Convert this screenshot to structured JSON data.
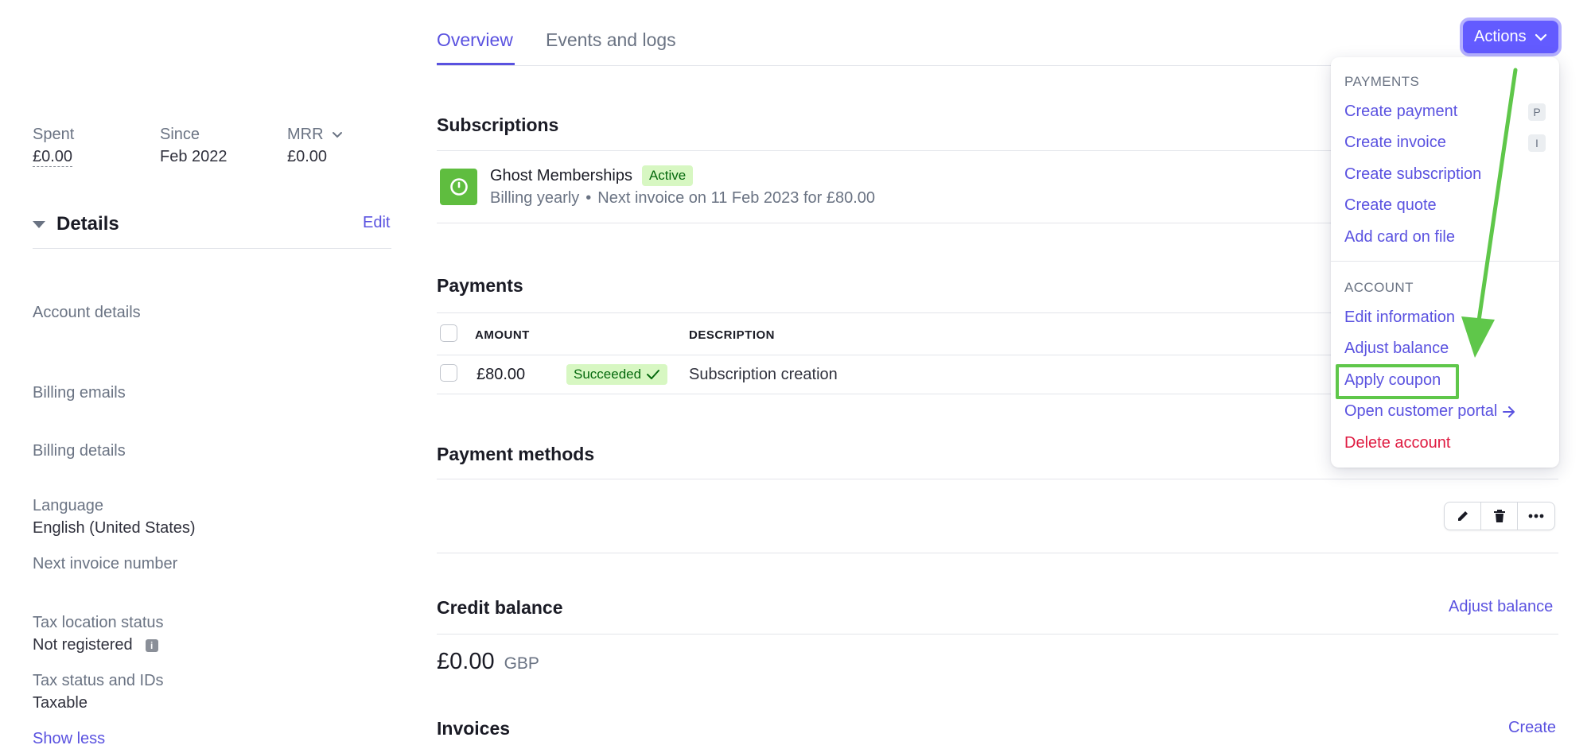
{
  "stats": {
    "spent_label": "Spent",
    "spent_value": "£0.00",
    "since_label": "Since",
    "since_value": "Feb 2022",
    "mrr_label": "MRR",
    "mrr_value": "£0.00"
  },
  "details": {
    "title": "Details",
    "edit_label": "Edit",
    "account_details": "Account details",
    "billing_emails": "Billing emails",
    "billing_details": "Billing details",
    "language_label": "Language",
    "language_value": "English (United States)",
    "next_invoice_number": "Next invoice number",
    "tax_location_label": "Tax location status",
    "tax_location_value": "Not registered",
    "tax_status_label": "Tax status and IDs",
    "tax_status_value": "Taxable",
    "show_less": "Show less"
  },
  "tabs": [
    {
      "label": "Overview"
    },
    {
      "label": "Events and logs"
    }
  ],
  "actions_button": {
    "label": "Actions"
  },
  "subscriptions": {
    "title": "Subscriptions",
    "name": "Ghost Memberships",
    "status": "Active",
    "billing": "Billing yearly",
    "next_invoice": "Next invoice on 11 Feb 2023 for £80.00"
  },
  "payments": {
    "title": "Payments",
    "columns": [
      "AMOUNT",
      "DESCRIPTION"
    ],
    "rows": [
      {
        "amount": "£80.00",
        "status": "Succeeded",
        "description": "Subscription creation"
      }
    ]
  },
  "payment_methods": {
    "title": "Payment methods"
  },
  "credit_balance": {
    "title": "Credit balance",
    "adjust_label": "Adjust balance",
    "amount": "£0.00",
    "currency": "GBP"
  },
  "invoices": {
    "title": "Invoices",
    "create_label": "Create"
  },
  "menu": {
    "payments_heading": "PAYMENTS",
    "create_payment": "Create payment",
    "create_payment_shortcut": "P",
    "create_invoice": "Create invoice",
    "create_invoice_shortcut": "I",
    "create_subscription": "Create subscription",
    "create_quote": "Create quote",
    "add_card": "Add card on file",
    "account_heading": "ACCOUNT",
    "edit_information": "Edit information",
    "adjust_balance": "Adjust balance",
    "apply_coupon": "Apply coupon",
    "open_portal": "Open customer portal",
    "delete_account": "Delete account"
  },
  "colors": {
    "accent": "#635bff",
    "link": "#5a52e0",
    "success_bg": "#d7f7c2",
    "success_text": "#05690d",
    "danger": "#df1b41",
    "annotation_green": "#5fc74a"
  }
}
